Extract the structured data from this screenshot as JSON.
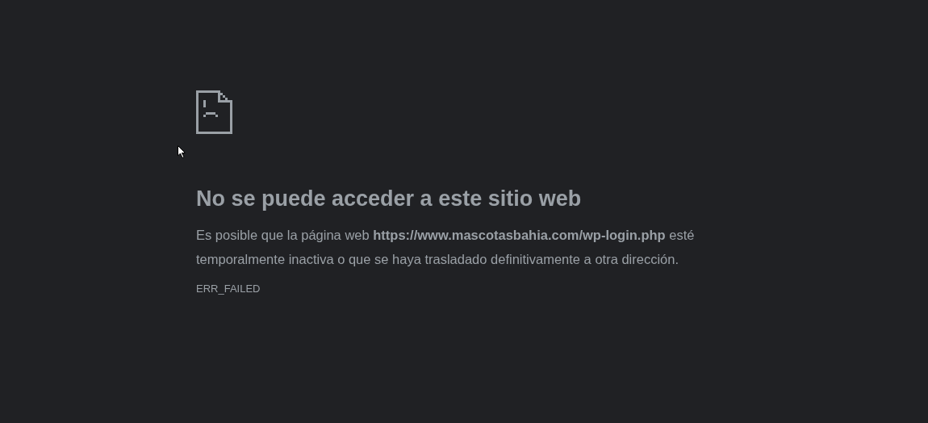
{
  "title": "No se puede acceder a este sitio web",
  "message": "Es posible que la página web **https://www.mascotasbahia.com/wp-login.php** esté temporalmente inactiva o que se haya trasladado definitivamente a otra dirección.",
  "error_code": "ERR_FAILED"
}
